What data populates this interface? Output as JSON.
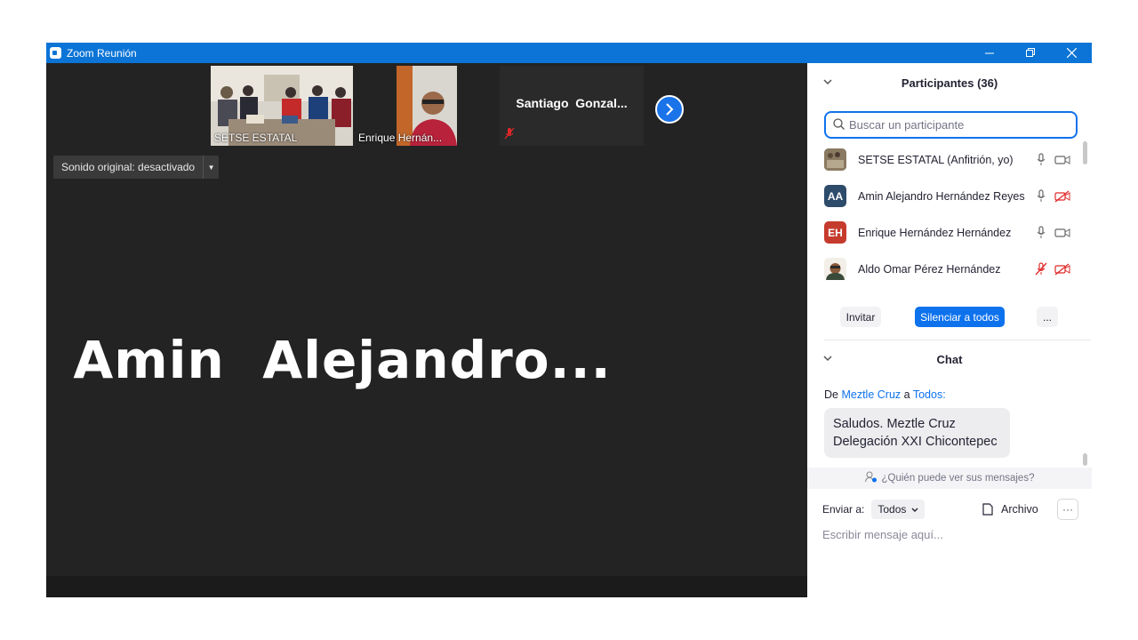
{
  "window": {
    "title": "Zoom Reunión"
  },
  "video": {
    "thumbnails": [
      {
        "label": "SETSE ESTATAL"
      },
      {
        "label": "Enrique Hernán..."
      },
      {
        "label": "Santiago  Gonzal..."
      }
    ],
    "audio_toggle": "Sonido original: desactivado",
    "active_speaker": "Amin  Alejandro..."
  },
  "participants": {
    "header": "Participantes (36)",
    "search_placeholder": "Buscar un participante",
    "list": [
      {
        "name": "SETSE ESTATAL (Anfitrión, yo)",
        "initials": "",
        "avatar_color": "#7a6a55",
        "mic": "on",
        "video": "on"
      },
      {
        "name": "Amin Alejandro Hernández Reyes",
        "initials": "AA",
        "avatar_color": "#2d4b6b",
        "mic": "on",
        "video": "off"
      },
      {
        "name": "Enrique Hernández Hernández",
        "initials": "EH",
        "avatar_color": "#c53b2d",
        "mic": "on",
        "video": "on"
      },
      {
        "name": "Aldo Omar Pérez Hernández",
        "initials": "",
        "avatar_color": "#8a5a3a",
        "mic": "off",
        "video": "off"
      }
    ],
    "invite": "Invitar",
    "mute_all": "Silenciar a todos",
    "more": "..."
  },
  "chat": {
    "header": "Chat",
    "from_prefix": "De",
    "from_name": "Meztle Cruz",
    "from_mid": "a",
    "from_to": "Todos:",
    "message_line1": "Saludos. Meztle Cruz",
    "message_line2": "Delegación XXI Chicontepec",
    "who_can_see": "¿Quién puede ver sus mensajes?",
    "send_to_label": "Enviar a:",
    "send_to_value": "Todos",
    "file_label": "Archivo",
    "input_placeholder": "Escribir mensaje aquí..."
  },
  "colors": {
    "accent": "#0e72ed",
    "titlebar": "#0b74d6",
    "video_bg": "#232323",
    "muted_red": "#e02828"
  }
}
